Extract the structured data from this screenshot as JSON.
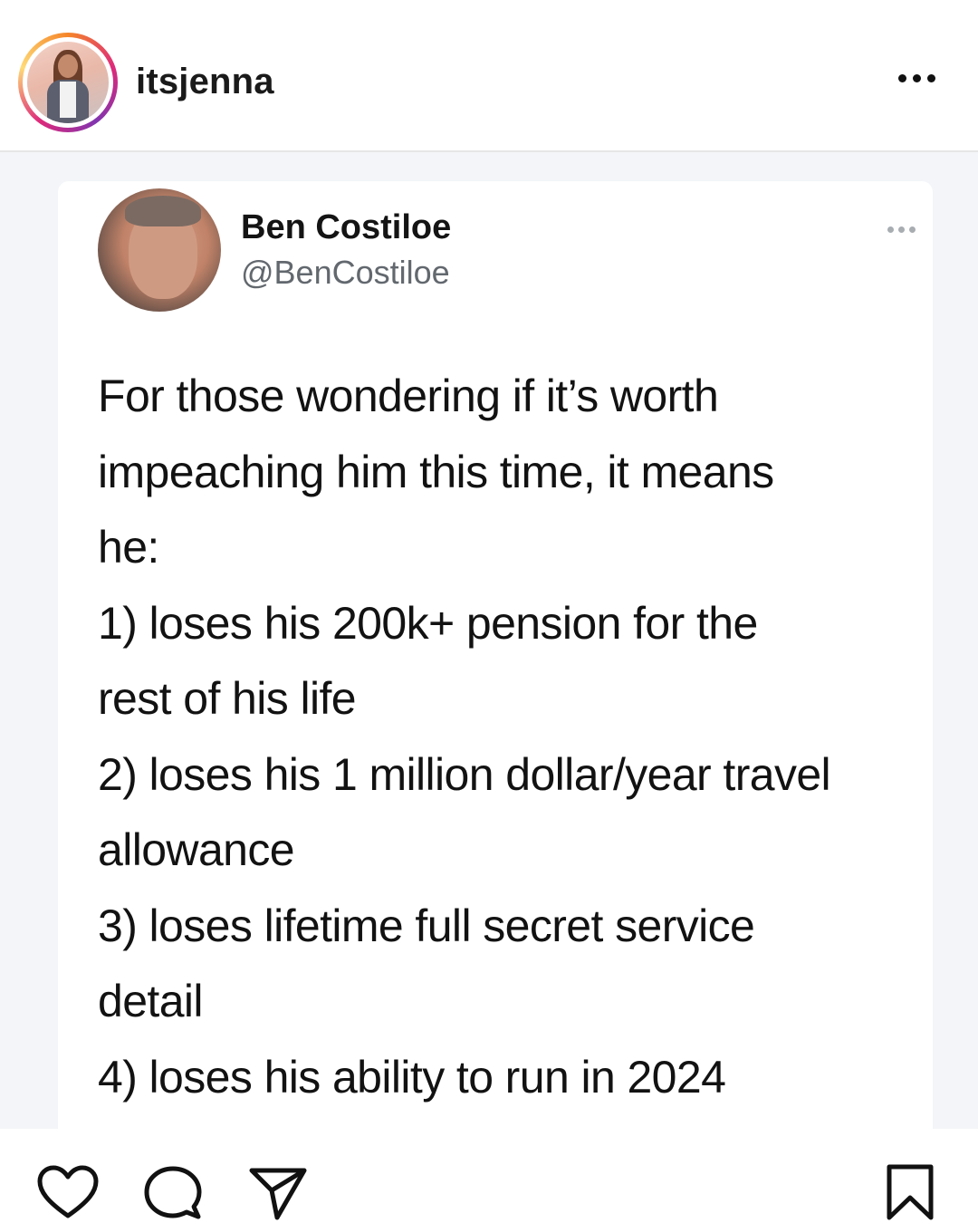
{
  "header": {
    "username": "itsjenna",
    "avatar_icon": "profile-avatar",
    "more_icon": "more-horizontal-icon"
  },
  "tweet": {
    "author_name": "Ben Costiloe",
    "author_handle": "@BenCostiloe",
    "more_icon": "more-horizontal-icon",
    "lines": [
      "For those wondering if it’s worth",
      "impeaching him this time, it means",
      "he:",
      "1) loses his 200k+ pension for the",
      "rest of his life",
      "2) loses his 1 million dollar/year travel",
      "allowance",
      "3) loses lifetime full secret service",
      "detail",
      "4) loses his ability to run in 2024"
    ]
  },
  "actions": {
    "icons": [
      "heart-icon",
      "comment-icon",
      "share-icon",
      "bookmark-icon"
    ]
  },
  "colors": {
    "story_ring": [
      "#f58529",
      "#dd2a7b",
      "#8134af",
      "#feda77"
    ],
    "text_primary": "#121212",
    "text_secondary": "#62686e"
  }
}
